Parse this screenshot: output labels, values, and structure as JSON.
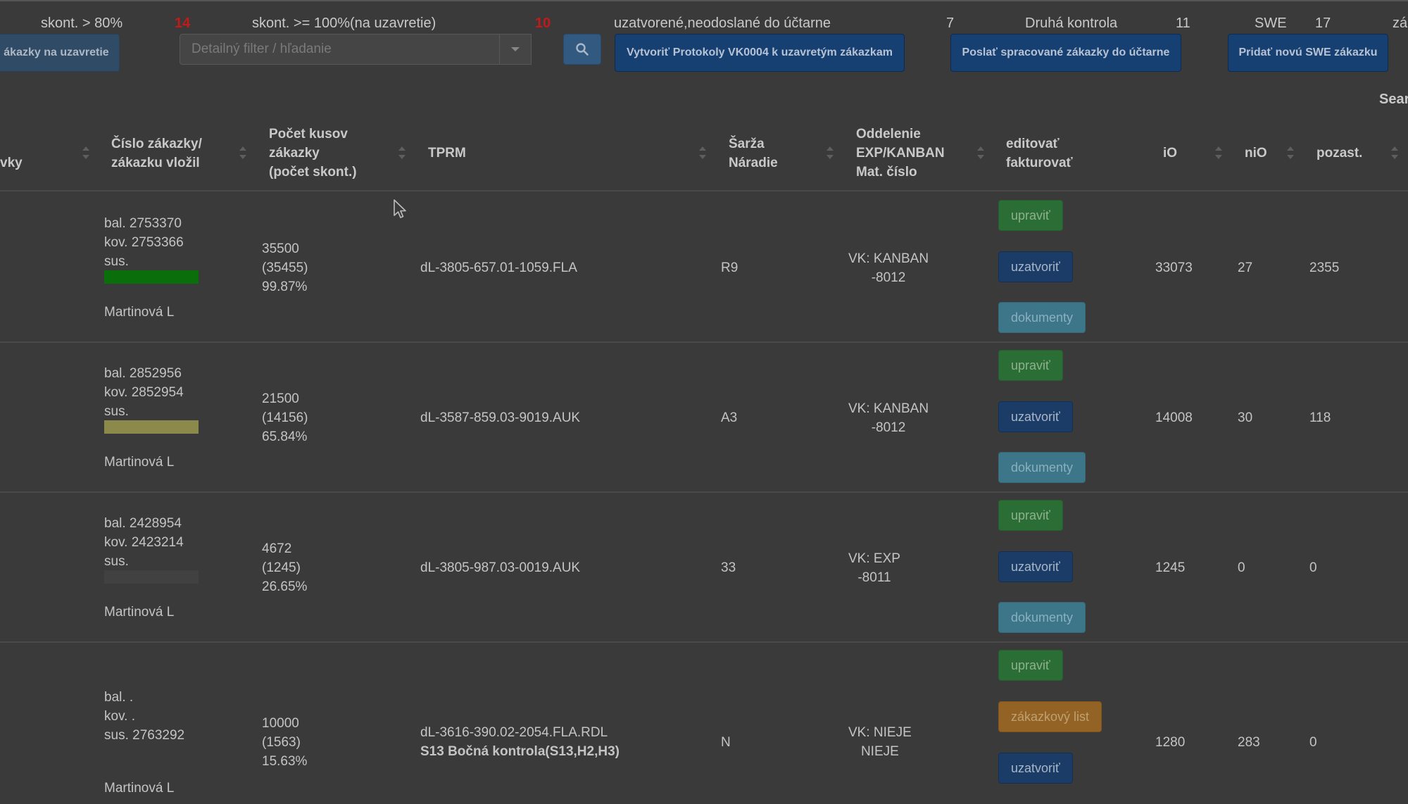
{
  "stats": {
    "skont80_label": "skont. > 80%",
    "skont80_count": "14",
    "skont100_label": "skont. >= 100%(na uzavretie)",
    "skont100_count": "10",
    "closed_label": "uzatvorené,neodoslané do účtarne",
    "closed_count": "7",
    "second_check_label": "Druhá kontrola",
    "second_check_count": "11",
    "swe_label": "SWE",
    "swe_count": "17",
    "cut_label": "zá"
  },
  "toolbar": {
    "to_close_label": "ákazky na uzavretie",
    "filter_placeholder": "Detailný filter / hľadanie",
    "create_protocols_label": "Vytvoriť Protokoly VK0004 k uzavretým zákazkam",
    "send_label": "Poslať spracované zákazky do účtarne",
    "add_swe_label": "Pridať novú SWE zákazku",
    "search_label": "Sear"
  },
  "table": {
    "headers": {
      "col0": "vky",
      "order": [
        "Číslo zákazky/",
        "zákazku vložil"
      ],
      "count": [
        "Počet kusov",
        "zákazky",
        "(počet skont.)"
      ],
      "tprm": "TPRM",
      "batch": [
        "Šarža",
        "Náradie"
      ],
      "dept": [
        "Oddelenie",
        "EXP/KANBAN",
        "Mat. číslo"
      ],
      "edit": [
        "editovať",
        "fakturovať"
      ],
      "io": "iO",
      "nio": "niO",
      "pozast": "pozast."
    },
    "rows": [
      {
        "bal": "bal. 2753370",
        "kov": "kov. 2753366",
        "sus": "sus.",
        "user": "Martinová L",
        "qty": "35500",
        "skont": "(35455)",
        "pct": "99.87%",
        "tprm": "dL-3805-657.01-1059.FLA",
        "batch": "R9",
        "dept1": "VK: KANBAN",
        "dept2": "-8012",
        "btn1": "upraviť",
        "btn2": "uzatvoriť",
        "btn3": "dokumenty",
        "io": "33073",
        "nio": "27",
        "pozast": "2355",
        "progress": 99.87,
        "bar_color": "#0a6e0a"
      },
      {
        "bal": "bal. 2852956",
        "kov": "kov. 2852954",
        "sus": "sus.",
        "user": "Martinová L",
        "qty": "21500",
        "skont": "(14156)",
        "pct": "65.84%",
        "tprm": "dL-3587-859.03-9019.AUK",
        "batch": "A3",
        "dept1": "VK: KANBAN",
        "dept2": "-8012",
        "btn1": "upraviť",
        "btn2": "uzatvoriť",
        "btn3": "dokumenty",
        "io": "14008",
        "nio": "30",
        "pozast": "118",
        "progress": 65.84,
        "bar_color": "#8c8a4a"
      },
      {
        "bal": "bal. 2428954",
        "kov": "kov. 2423214",
        "sus": "sus.",
        "user": "Martinová L",
        "qty": "4672",
        "skont": "(1245)",
        "pct": "26.65%",
        "tprm": "dL-3805-987.03-0019.AUK",
        "batch": "33",
        "dept1": "VK: EXP",
        "dept2": "-8011",
        "btn1": "upraviť",
        "btn2": "uzatvoriť",
        "btn3": "dokumenty",
        "io": "1245",
        "nio": "0",
        "pozast": "0",
        "progress": 26.65,
        "bar_color": "#414141"
      },
      {
        "bal": "bal. .",
        "kov": "kov. .",
        "sus": "sus. 2763292",
        "user": "Martinová L",
        "qty": "10000",
        "skont": "(1563)",
        "pct": "15.63%",
        "tprm": "dL-3616-390.02-2054.FLA.RDL",
        "tprm_note": "S13 Bočná kontrola(S13,H2,H3)",
        "batch": "N",
        "dept1": "VK: NIEJE",
        "dept2": "NIEJE",
        "btn1": "upraviť",
        "btn2": "zákazkový list",
        "btn3": "uzatvoriť",
        "io": "1280",
        "nio": "283",
        "pozast": "0"
      }
    ]
  },
  "colors": {
    "background": "#3a3a3a",
    "alert_red": "#c21a1a",
    "primary_blue": "#163f72",
    "success_green": "#2b6e35",
    "info_teal": "#3d7689",
    "warning_orange": "#936325"
  }
}
